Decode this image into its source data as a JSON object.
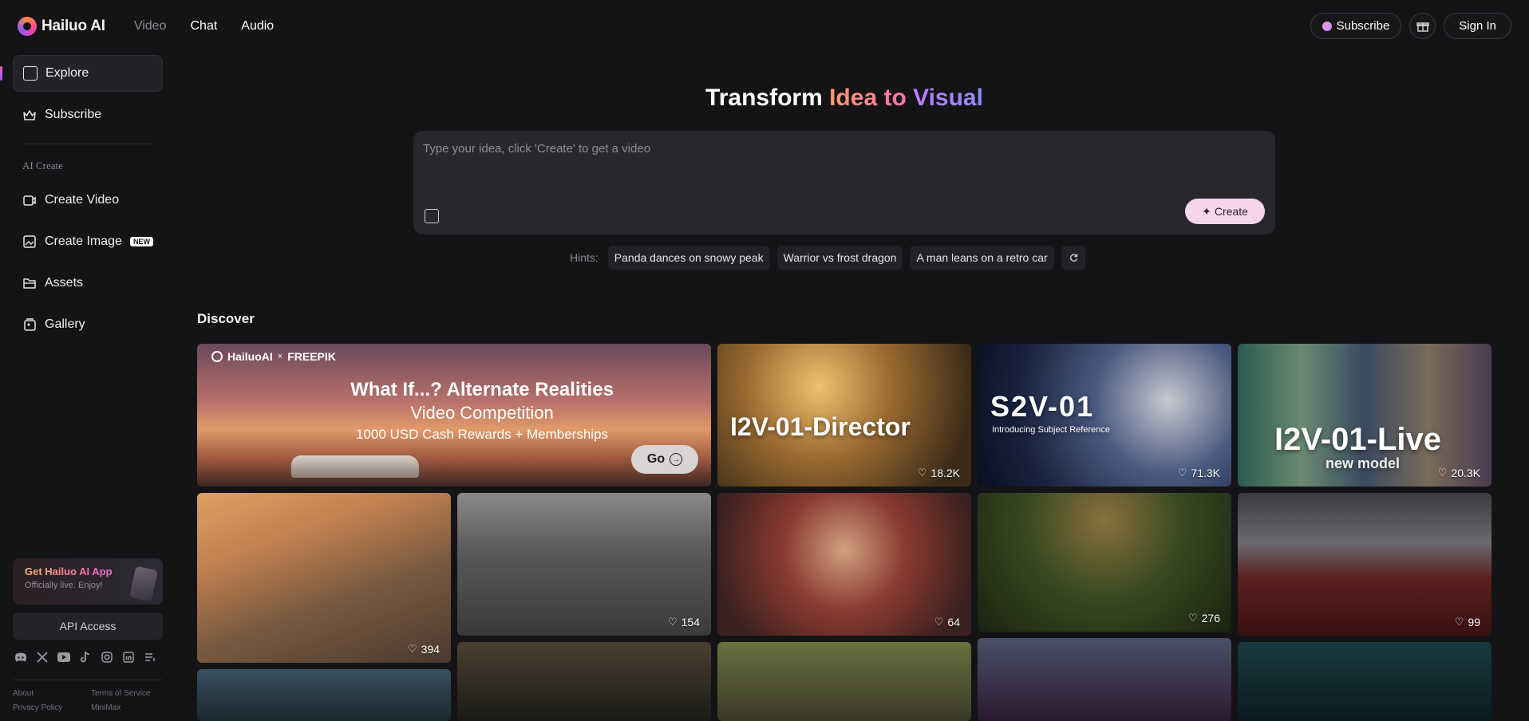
{
  "topbar": {
    "brand": "Hailuo AI",
    "tabs": [
      "Video",
      "Chat",
      "Audio"
    ],
    "subscribe_label": "Subscribe",
    "signin_label": "Sign In"
  },
  "sidebar": {
    "items": [
      {
        "label": "Explore",
        "icon": "explore-icon"
      },
      {
        "label": "Subscribe",
        "icon": "crown-icon"
      }
    ],
    "section_label": "AI Create",
    "create_items": [
      {
        "label": "Create Video",
        "icon": "video-icon"
      },
      {
        "label": "Create Image",
        "icon": "image-icon",
        "badge": "NEW"
      },
      {
        "label": "Assets",
        "icon": "folder-icon"
      },
      {
        "label": "Gallery",
        "icon": "gallery-icon"
      }
    ],
    "app_card": {
      "title": "Get Hailuo AI App",
      "subtitle": "Officially live. Enjoy!"
    },
    "api_label": "API Access",
    "footer": {
      "about": "About",
      "privacy": "Privacy Policy",
      "terms": "Terms of Service",
      "company": "MiniMax"
    }
  },
  "hero": {
    "title_plain": "Transform ",
    "title_idea": "Idea to ",
    "title_visual": "Visual",
    "placeholder": "Type your idea, click 'Create' to get a video",
    "create_label": "Create",
    "hints_label": "Hints:",
    "hints": [
      "Panda dances on snowy peak",
      "Warrior vs frost dragon",
      "A man leans on a retro car"
    ]
  },
  "discover": {
    "title": "Discover",
    "banner": {
      "brand": "HailuoAI",
      "x": "×",
      "partner": "FREEPIK",
      "title": "What If...? Alternate Realities",
      "subtitle": "Video Competition",
      "reward": "1000 USD Cash Rewards + Memberships",
      "go_label": "Go"
    },
    "cards": [
      {
        "overlay": "I2V-01-Director",
        "likes": "18.2K"
      },
      {
        "overlay": "S2V-01",
        "overlay_sub": "Introducing Subject Reference",
        "likes": "71.3K"
      },
      {
        "overlay": "I2V-01-Live",
        "overlay_sub": "new model",
        "likes": "20.3K"
      },
      {
        "likes": "394"
      },
      {
        "likes": "154"
      },
      {
        "likes": "64"
      },
      {
        "likes": "276"
      },
      {
        "likes": "99"
      }
    ]
  },
  "colors": {
    "background": "#141416",
    "accent_pink": "#ff6fb0",
    "accent_purple": "#8a8cff",
    "create_button": "#f5d6ee"
  }
}
